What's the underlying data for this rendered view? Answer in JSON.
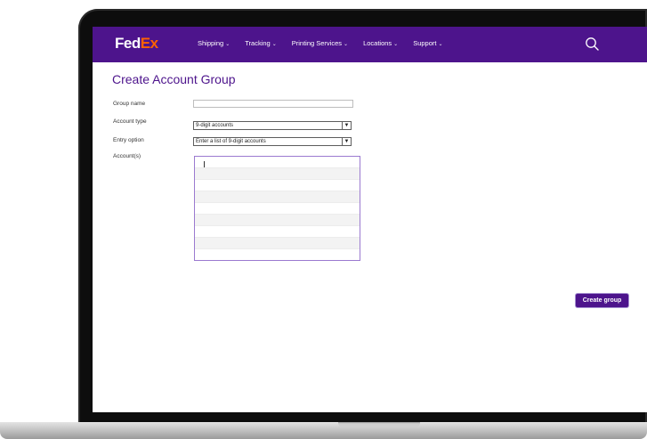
{
  "header": {
    "logo_fed": "Fed",
    "logo_ex": "Ex",
    "nav": [
      {
        "label": "Shipping"
      },
      {
        "label": "Tracking"
      },
      {
        "label": "Printing Services"
      },
      {
        "label": "Locations"
      },
      {
        "label": "Support"
      }
    ],
    "search_icon": "search-icon"
  },
  "form": {
    "title": "Create Account Group",
    "group_name_label": "Group name",
    "group_name_value": "",
    "account_type_label": "Account type",
    "account_type_value": "9-digit accounts",
    "entry_option_label": "Entry option",
    "entry_option_value": "Enter a list of 9-digit accounts",
    "accounts_label": "Account(s)",
    "create_button": "Create group"
  },
  "colors": {
    "brand_purple": "#4d148c",
    "brand_orange": "#ff6200"
  }
}
